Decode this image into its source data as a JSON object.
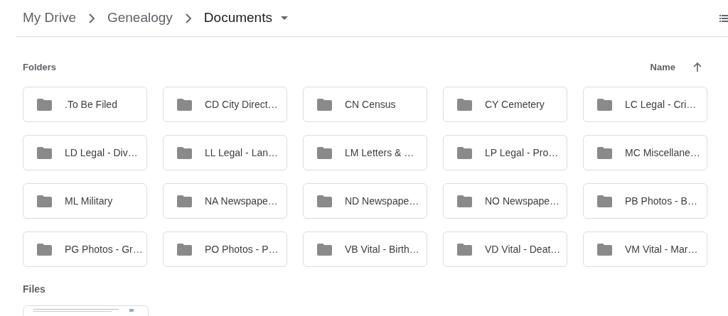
{
  "breadcrumb": [
    {
      "label": "My Drive",
      "current": false
    },
    {
      "label": "Genealogy",
      "current": false
    },
    {
      "label": "Documents",
      "current": true
    }
  ],
  "folders_section": {
    "title": "Folders",
    "sort_label": "Name"
  },
  "folders": [
    {
      "name": ".To Be Filed"
    },
    {
      "name": "CD City Direct…"
    },
    {
      "name": "CN Census"
    },
    {
      "name": "CY Cemetery"
    },
    {
      "name": "LC Legal - Cri…"
    },
    {
      "name": "LD Legal - Div…"
    },
    {
      "name": "LL Legal - Lan…"
    },
    {
      "name": "LM Letters & …"
    },
    {
      "name": "LP Legal - Pro…"
    },
    {
      "name": "MC Miscellane…"
    },
    {
      "name": "ML Military"
    },
    {
      "name": "NA Newspape…"
    },
    {
      "name": "ND Newspape…"
    },
    {
      "name": "NO Newspape…"
    },
    {
      "name": "PB Photos - B…"
    },
    {
      "name": "PG Photos - Gr…"
    },
    {
      "name": "PO Photos - P…"
    },
    {
      "name": "VB Vital - Birth…"
    },
    {
      "name": "VD Vital - Deat…"
    },
    {
      "name": "VM Vital - Mar…"
    }
  ],
  "files_section": {
    "title": "Files"
  }
}
